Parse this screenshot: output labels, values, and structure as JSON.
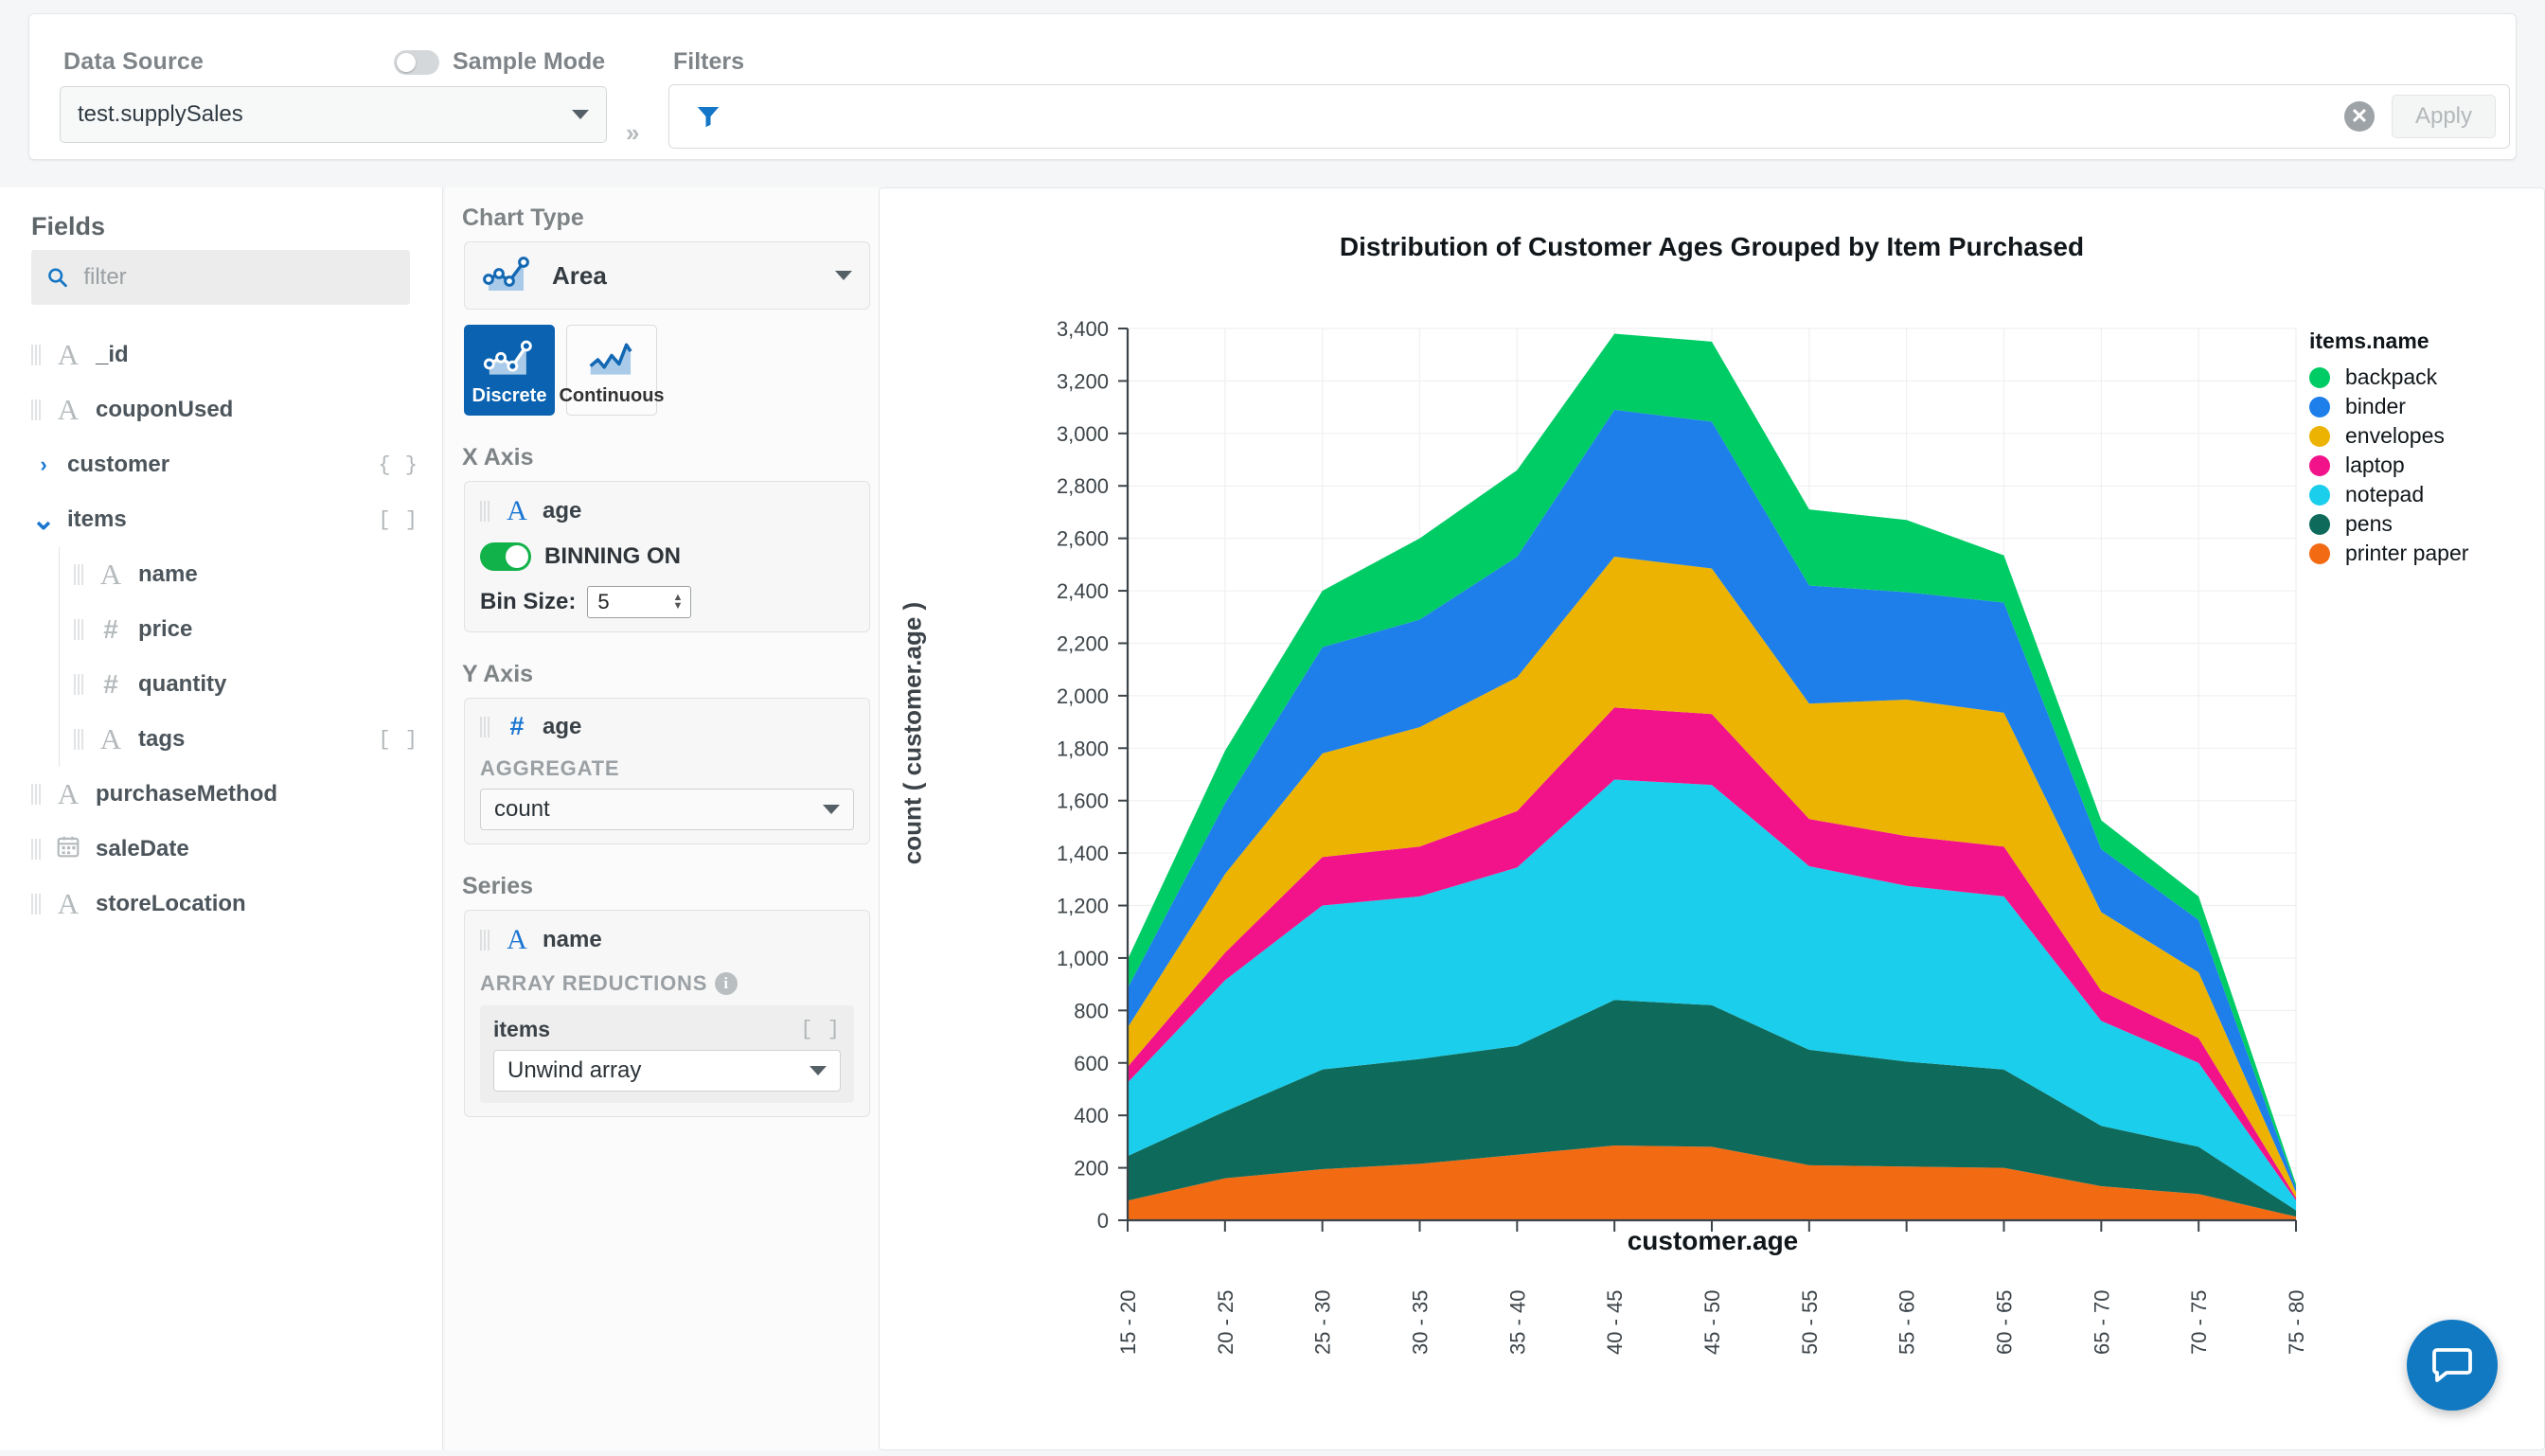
{
  "topbar": {
    "data_source_label": "Data Source",
    "data_source_value": "test.supplySales",
    "sample_mode_label": "Sample Mode",
    "sample_mode_on": false,
    "filters_label": "Filters",
    "filter_value": "",
    "filter_placeholder": "",
    "apply_label": "Apply"
  },
  "fields": {
    "title": "Fields",
    "filter_placeholder": "filter",
    "filter_value": "",
    "items": [
      {
        "label": "_id",
        "type": "string",
        "level": 0,
        "expander": "",
        "tag": ""
      },
      {
        "label": "couponUsed",
        "type": "string",
        "level": 0,
        "expander": "",
        "tag": ""
      },
      {
        "label": "customer",
        "type": "object",
        "level": 0,
        "expander": "collapsed",
        "tag": "{ }"
      },
      {
        "label": "items",
        "type": "array",
        "level": 0,
        "expander": "expanded",
        "tag": "[ ]"
      },
      {
        "label": "name",
        "type": "string",
        "level": 1,
        "expander": "",
        "tag": ""
      },
      {
        "label": "price",
        "type": "number",
        "level": 1,
        "expander": "",
        "tag": ""
      },
      {
        "label": "quantity",
        "type": "number",
        "level": 1,
        "expander": "",
        "tag": ""
      },
      {
        "label": "tags",
        "type": "string",
        "level": 1,
        "expander": "",
        "tag": "[ ]"
      },
      {
        "label": "purchaseMethod",
        "type": "string",
        "level": 0,
        "expander": "",
        "tag": ""
      },
      {
        "label": "saleDate",
        "type": "date",
        "level": 0,
        "expander": "",
        "tag": ""
      },
      {
        "label": "storeLocation",
        "type": "string",
        "level": 0,
        "expander": "",
        "tag": ""
      }
    ]
  },
  "encoding": {
    "chart_type": {
      "title": "Chart Type",
      "value": "Area",
      "discrete_label": "Discrete",
      "continuous_label": "Continuous",
      "selected_mode": "Discrete"
    },
    "x_axis": {
      "title": "X Axis",
      "field": "age",
      "field_type": "string",
      "binning_label": "BINNING ON",
      "binning_on": true,
      "bin_size_label": "Bin Size:",
      "bin_size_value": "5"
    },
    "y_axis": {
      "title": "Y Axis",
      "field": "age",
      "field_type": "number",
      "aggregate_label": "AGGREGATE",
      "aggregate_value": "count"
    },
    "series": {
      "title": "Series",
      "field": "name",
      "field_type": "string",
      "array_reductions_label": "ARRAY REDUCTIONS",
      "reduction_field": "items",
      "reduction_tag": "[ ]",
      "reduction_value": "Unwind array"
    }
  },
  "chart_data": {
    "type": "area",
    "stacked": true,
    "title": "Distribution of Customer Ages Grouped by Item Purchased",
    "xlabel": "customer.age",
    "ylabel": "count ( customer.age )",
    "legend_title": "items.name",
    "legend_position": "right",
    "grid": true,
    "ylim": [
      0,
      3400
    ],
    "ytick_step": 200,
    "yticks": [
      "0",
      "200",
      "400",
      "600",
      "800",
      "1,000",
      "1,200",
      "1,400",
      "1,600",
      "1,800",
      "2,000",
      "2,200",
      "2,400",
      "2,600",
      "2,800",
      "3,000",
      "3,200",
      "3,400"
    ],
    "categories": [
      "15 - 20",
      "20 - 25",
      "25 - 30",
      "30 - 35",
      "35 - 40",
      "40 - 45",
      "45 - 50",
      "50 - 55",
      "55 - 60",
      "60 - 65",
      "65 - 70",
      "70 - 75",
      "75 - 80"
    ],
    "stack_order_bottom_to_top": [
      "printer paper",
      "pens",
      "notepad",
      "laptop",
      "envelopes",
      "binder",
      "backpack"
    ],
    "series": [
      {
        "name": "backpack",
        "color": "#00CC66",
        "values": [
          110,
          200,
          215,
          310,
          330,
          290,
          305,
          290,
          275,
          180,
          110,
          90,
          12
        ]
      },
      {
        "name": "binder",
        "color": "#1E7FEA",
        "values": [
          150,
          270,
          405,
          410,
          460,
          560,
          560,
          450,
          410,
          420,
          240,
          200,
          18
        ]
      },
      {
        "name": "envelopes",
        "color": "#EDB302",
        "values": [
          150,
          300,
          395,
          455,
          510,
          575,
          555,
          440,
          520,
          510,
          300,
          250,
          22
        ]
      },
      {
        "name": "laptop",
        "color": "#F2138A",
        "values": [
          60,
          105,
          185,
          190,
          215,
          275,
          270,
          180,
          190,
          190,
          115,
          95,
          10
        ]
      },
      {
        "name": "notepad",
        "color": "#1BCEEC",
        "values": [
          280,
          500,
          625,
          620,
          680,
          840,
          840,
          700,
          670,
          660,
          400,
          320,
          38
        ]
      },
      {
        "name": "pens",
        "color": "#0E6B5B",
        "values": [
          170,
          255,
          380,
          400,
          415,
          555,
          540,
          440,
          400,
          375,
          230,
          180,
          24
        ]
      },
      {
        "name": "printer paper",
        "color": "#F26B13",
        "values": [
          75,
          160,
          195,
          215,
          250,
          285,
          280,
          210,
          205,
          200,
          130,
          100,
          14
        ]
      }
    ],
    "totals": [
      995,
      1790,
      2400,
      2600,
      2860,
      3380,
      3350,
      2710,
      2670,
      2535,
      1525,
      1235,
      138
    ]
  },
  "chat": {
    "label": "chat-launcher"
  }
}
